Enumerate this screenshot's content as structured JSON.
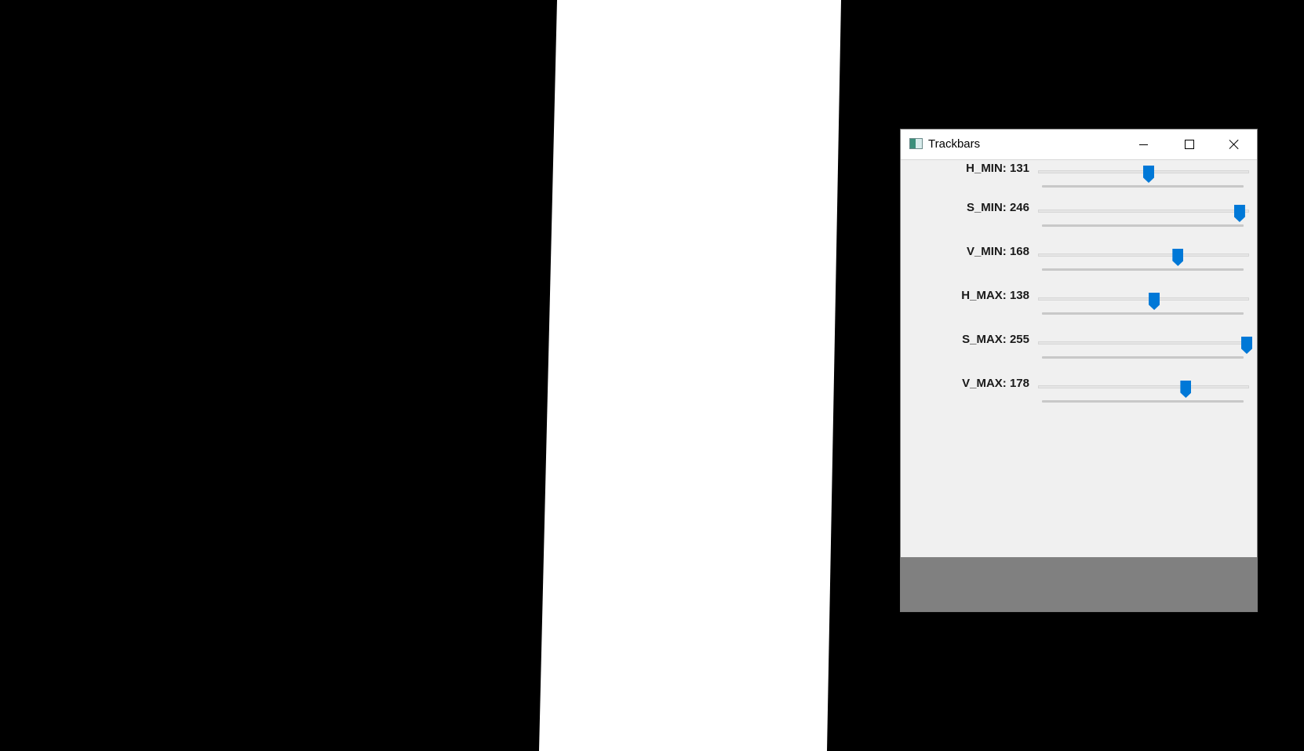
{
  "window": {
    "title": "Trackbars",
    "icon": "app-window-icon",
    "controls": [
      "minimize-icon",
      "maximize-icon",
      "close-icon"
    ]
  },
  "trackbars": [
    {
      "label": "H_MIN: 131",
      "value": 131,
      "max": 255
    },
    {
      "label": "S_MIN: 246",
      "value": 246,
      "max": 255
    },
    {
      "label": "V_MIN: 168",
      "value": 168,
      "max": 255
    },
    {
      "label": "H_MAX: 138",
      "value": 138,
      "max": 255
    },
    {
      "label": "S_MAX: 255",
      "value": 255,
      "max": 255
    },
    {
      "label": "V_MAX: 178",
      "value": 178,
      "max": 255
    }
  ],
  "colors": {
    "thumb": "#0078d7",
    "window_bg": "#f0f0f0",
    "bottom_panel": "#808080",
    "mask_background": "#000000",
    "mask_foreground": "#ffffff"
  }
}
